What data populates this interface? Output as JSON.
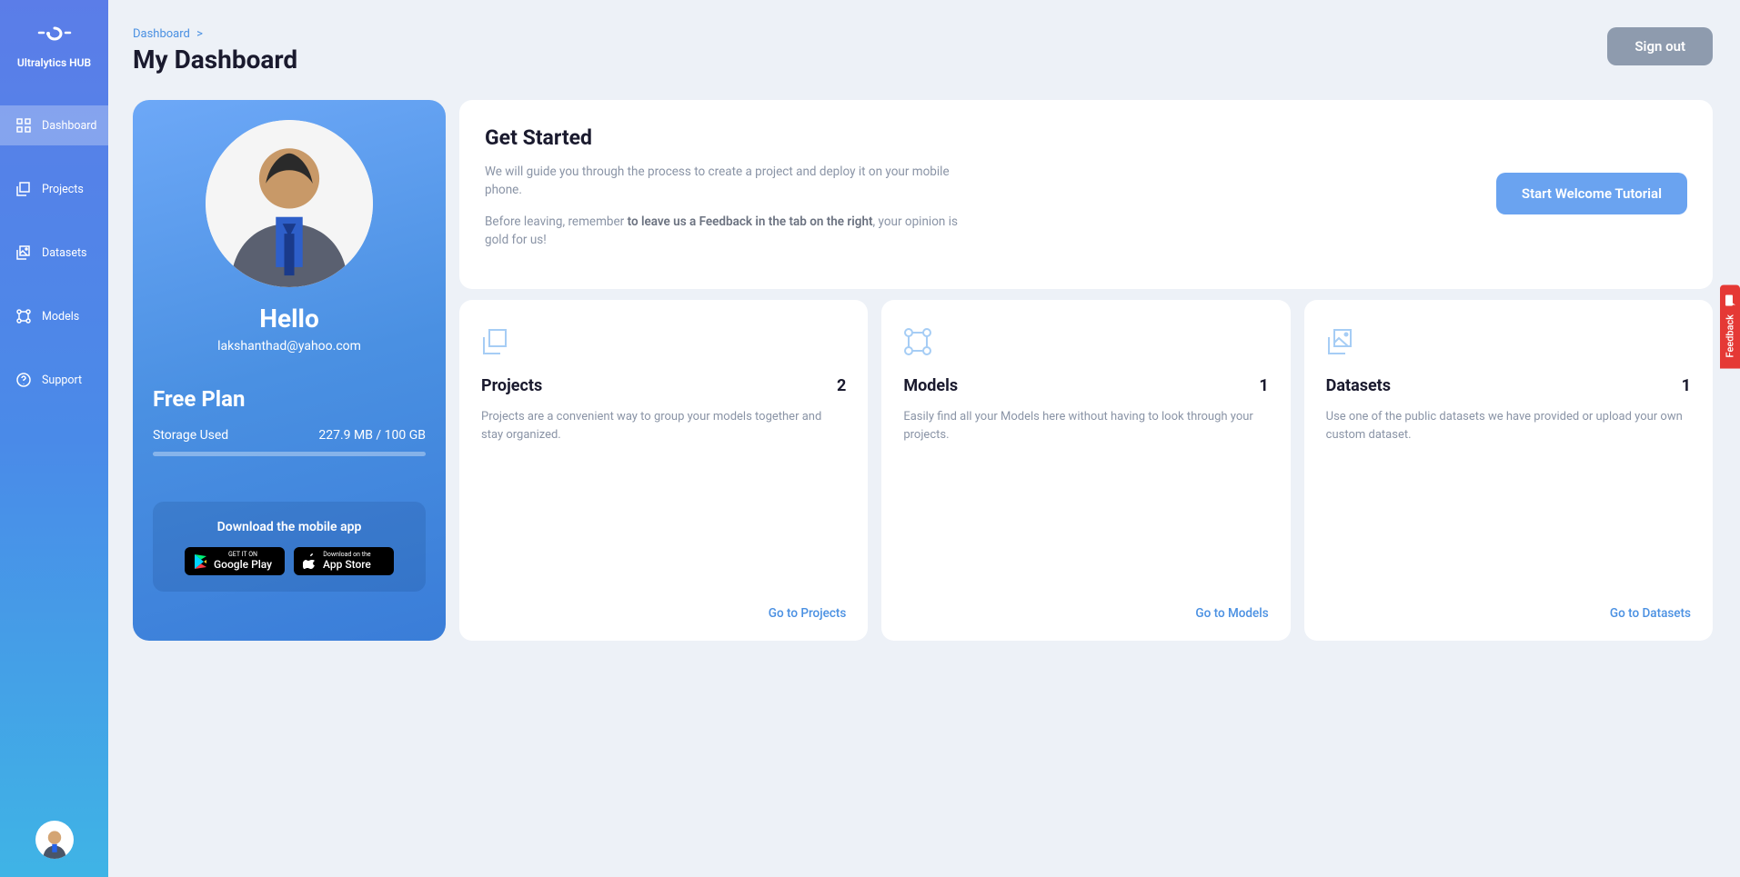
{
  "app_name": "Ultralytics HUB",
  "breadcrumb": {
    "item": "Dashboard",
    "sep": ">"
  },
  "page_title": "My Dashboard",
  "signout": "Sign out",
  "nav": {
    "dashboard": "Dashboard",
    "projects": "Projects",
    "datasets": "Datasets",
    "models": "Models",
    "support": "Support"
  },
  "profile": {
    "hello": "Hello",
    "email": "lakshanthad@yahoo.com",
    "plan": "Free Plan",
    "storage_label": "Storage Used",
    "storage_value": "227.9 MB / 100 GB",
    "download_title": "Download the mobile app",
    "google_small": "GET IT ON",
    "google_big": "Google Play",
    "apple_small": "Download on the",
    "apple_big": "App Store"
  },
  "get_started": {
    "title": "Get Started",
    "text1": "We will guide you through the process to create a project and deploy it on your mobile phone.",
    "text2a": "Before leaving, remember ",
    "text2b": "to leave us a Feedback in the tab on the right",
    "text2c": ", your opinion is gold for us!",
    "button": "Start Welcome Tutorial"
  },
  "cards": {
    "projects": {
      "title": "Projects",
      "count": "2",
      "desc": "Projects are a convenient way to group your models together and stay organized.",
      "link": "Go to Projects"
    },
    "models": {
      "title": "Models",
      "count": "1",
      "desc": "Easily find all your Models here without having to look through your projects.",
      "link": "Go to Models"
    },
    "datasets": {
      "title": "Datasets",
      "count": "1",
      "desc": "Use one of the public datasets we have provided or upload your own custom dataset.",
      "link": "Go to Datasets"
    }
  },
  "feedback": "Feedback"
}
